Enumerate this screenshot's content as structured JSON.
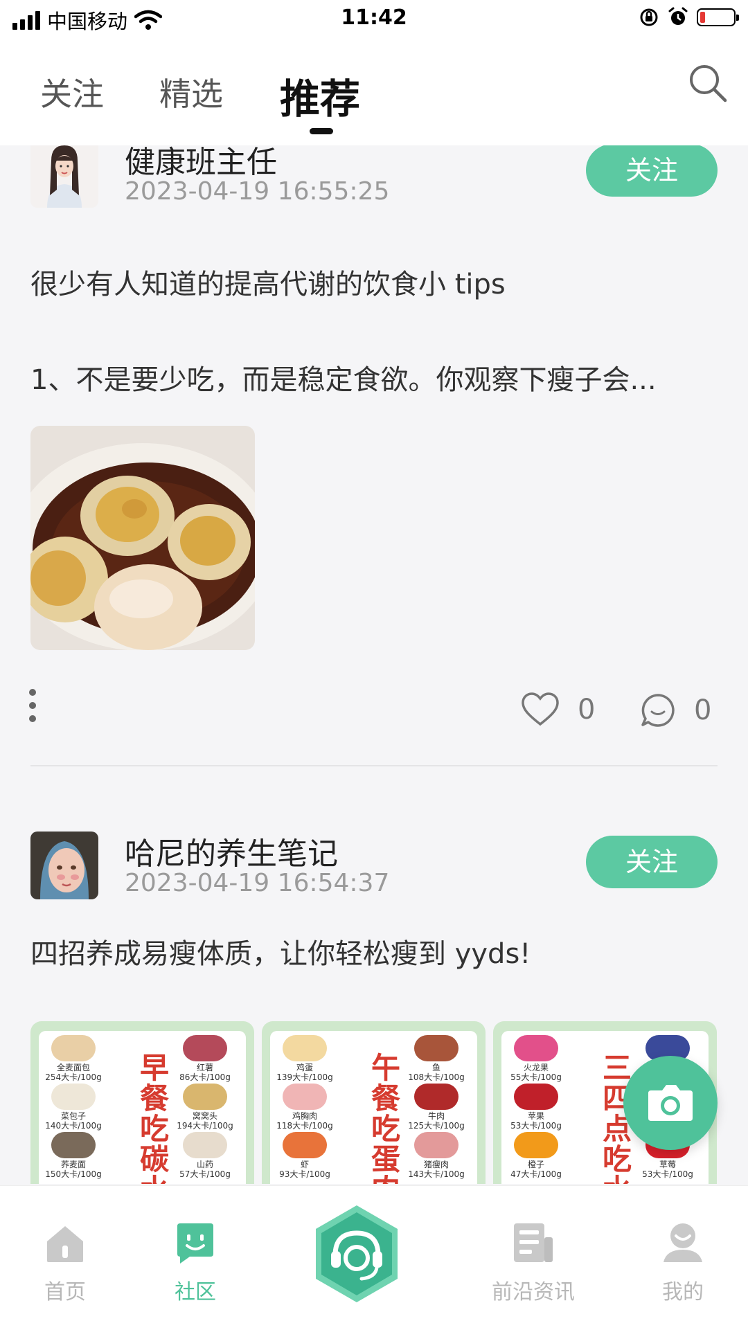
{
  "status_bar": {
    "carrier": "中国移动",
    "time": "11:42"
  },
  "top_tabs": [
    {
      "label": "关注"
    },
    {
      "label": "精选"
    },
    {
      "label": "推荐",
      "active": true
    }
  ],
  "posts": [
    {
      "author": "健康班主任",
      "time": "2023-04-19 16:55:25",
      "follow_label": "关注",
      "title": "很少有人知道的提高代谢的饮食小 tips",
      "excerpt": "1、不是要少吃，而是稳定食欲。你观察下瘦子会...",
      "likes": "0",
      "comments": "0"
    },
    {
      "author": "哈尼的养生笔记",
      "time": "2023-04-19 16:54:37",
      "follow_label": "关注",
      "title": "四招养成易瘦体质，让你轻松瘦到 yyds!",
      "cards": [
        {
          "title": "早餐吃碳水",
          "foods": [
            {
              "name": "全麦面包",
              "kcal": "254大卡/100g"
            },
            {
              "name": "红薯",
              "kcal": "86大卡/100g"
            },
            {
              "name": "菜包子",
              "kcal": "140大卡/100g"
            },
            {
              "name": "窝窝头",
              "kcal": "194大卡/100g"
            },
            {
              "name": "荞麦面",
              "kcal": "150大卡/100g"
            },
            {
              "name": "山药",
              "kcal": "57大卡/100g"
            }
          ]
        },
        {
          "title": "午餐吃蛋肉",
          "foods": [
            {
              "name": "鸡蛋",
              "kcal": "139大卡/100g"
            },
            {
              "name": "鱼",
              "kcal": "108大卡/100g"
            },
            {
              "name": "鸡胸肉",
              "kcal": "118大卡/100g"
            },
            {
              "name": "牛肉",
              "kcal": "125大卡/100g"
            },
            {
              "name": "虾",
              "kcal": "93大卡/100g"
            },
            {
              "name": "猪瘦肉",
              "kcal": "143大卡/100g"
            }
          ]
        },
        {
          "title": "三四点吃水",
          "foods": [
            {
              "name": "火龙果",
              "kcal": "55大卡/100g"
            },
            {
              "name": "",
              "kcal": ""
            },
            {
              "name": "苹果",
              "kcal": "53大卡/100g"
            },
            {
              "name": "",
              "kcal": ""
            },
            {
              "name": "橙子",
              "kcal": "47大卡/100g"
            },
            {
              "name": "草莓",
              "kcal": "53大卡/100g"
            }
          ]
        }
      ]
    }
  ],
  "bottom_nav": [
    {
      "label": "首页",
      "icon": "home-icon"
    },
    {
      "label": "社区",
      "icon": "community-icon",
      "active": true
    },
    {
      "label": "",
      "icon": "assistant-headset-icon"
    },
    {
      "label": "前沿资讯",
      "icon": "news-icon"
    },
    {
      "label": "我的",
      "icon": "profile-icon"
    }
  ],
  "colors": {
    "accent": "#5cc9a2",
    "fab": "#4fc29a",
    "title_red": "#d63b2f"
  }
}
